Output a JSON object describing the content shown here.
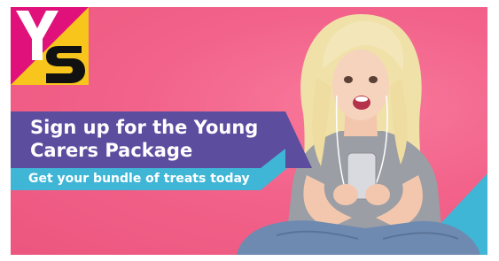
{
  "banner": {
    "headline_line1": "Sign up for the Young",
    "headline_line2": "Carers Package",
    "subheadline": "Get your bundle of treats today"
  },
  "logo": {
    "letters": "YS",
    "colors": {
      "magenta": "#e0117a",
      "yellow": "#f7c51c",
      "black": "#111111"
    }
  },
  "colors": {
    "background_pink": "#f25f86",
    "title_purple": "#5c4d9f",
    "subtitle_cyan": "#3fb6d6",
    "text_white": "#ffffff"
  }
}
